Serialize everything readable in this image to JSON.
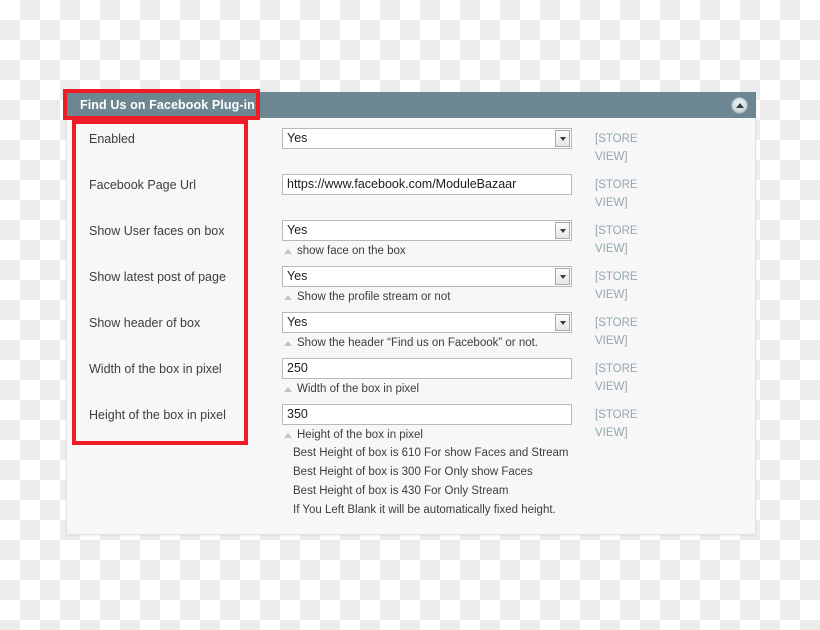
{
  "panel": {
    "title": "Find Us on Facebook Plug-in",
    "collapse_icon": "triangle-up-icon",
    "scope_label": "[STORE\nVIEW]"
  },
  "rows": [
    {
      "label": "Enabled",
      "field_type": "select",
      "value": "Yes",
      "hint": "",
      "scope": "[STORE\nVIEW]"
    },
    {
      "label": "Facebook Page Url",
      "field_type": "text",
      "value": "https://www.facebook.com/ModuleBazaar",
      "hint": "",
      "scope": "[STORE\nVIEW]"
    },
    {
      "label": "Show User faces on box",
      "field_type": "select",
      "value": "Yes",
      "hint": "show face on the box",
      "scope": "[STORE\nVIEW]"
    },
    {
      "label": "Show latest post of page",
      "field_type": "select",
      "value": "Yes",
      "hint": "Show the profile stream or not",
      "scope": "[STORE\nVIEW]"
    },
    {
      "label": "Show header of box",
      "field_type": "select",
      "value": "Yes",
      "hint": "Show the header “Find us on Facebook” or not.",
      "scope": "[STORE\nVIEW]"
    },
    {
      "label": "Width of the box in pixel",
      "field_type": "text",
      "value": "250",
      "hint": "Width of the box in pixel",
      "scope": "[STORE\nVIEW]"
    },
    {
      "label": "Height of the box in pixel",
      "field_type": "text",
      "value": "350",
      "hint": "Height of the box in pixel",
      "scope": "[STORE\nVIEW]",
      "extra_notes": [
        "Best Height of box is 610 For show Faces and Stream",
        "Best Height of box is 300 For Only show Faces",
        "Best Height of box is 430 For Only Stream",
        "If You Left Blank it will be automatically fixed height."
      ]
    }
  ],
  "annotations": {
    "title_highlight_color": "#ee1c25",
    "labels_highlight_color": "#ee1c25"
  },
  "colors": {
    "header_bar": "#6d8792",
    "panel_background": "#f7f7f7",
    "scope_text": "#93a7b0",
    "annotation_red": "#ee1c25"
  }
}
